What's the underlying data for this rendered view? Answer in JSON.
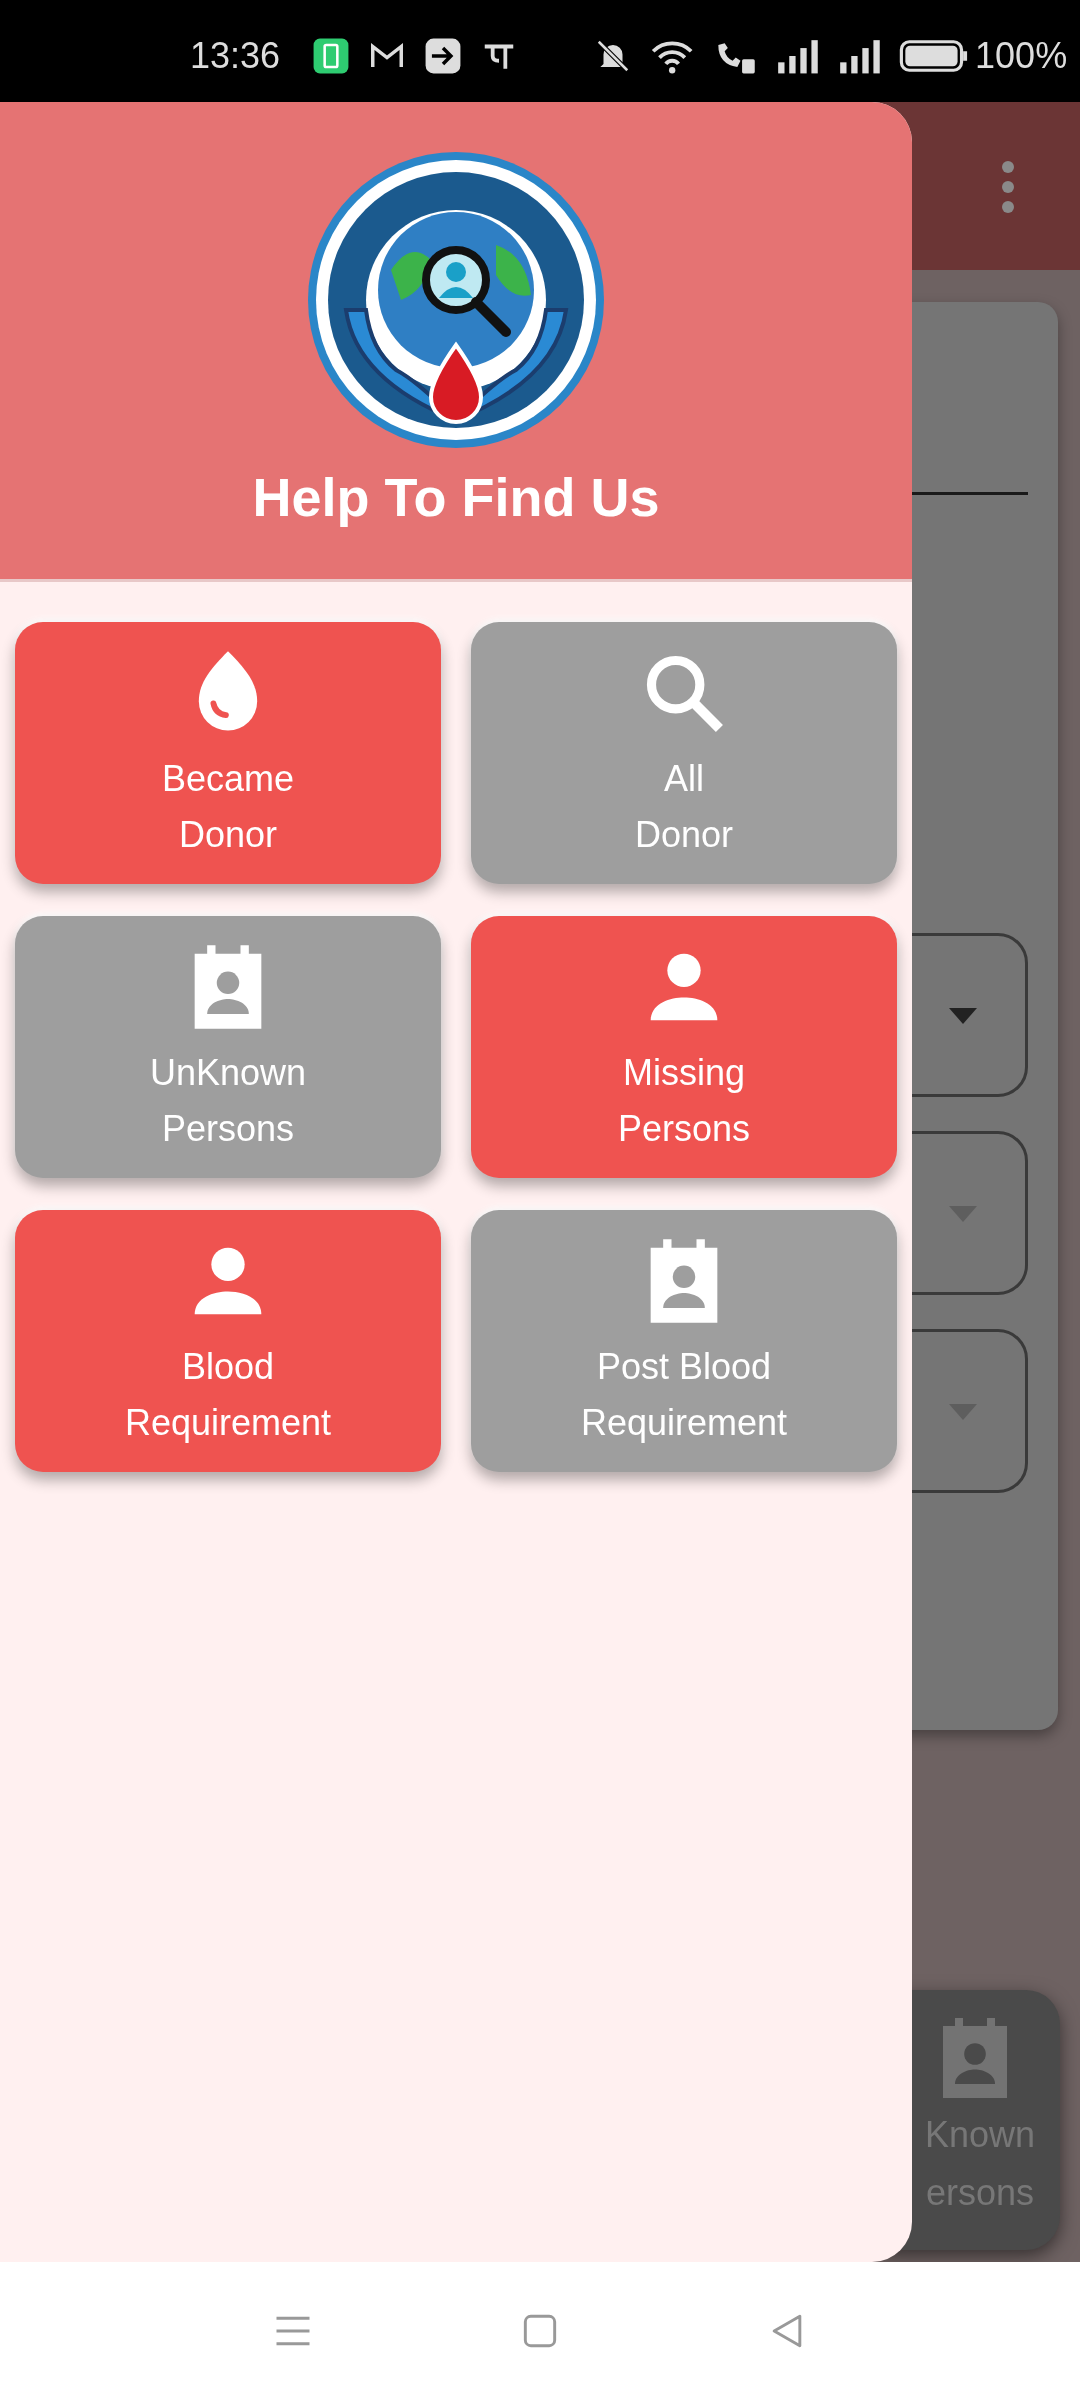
{
  "status_bar": {
    "time": "13:36",
    "battery": "100%"
  },
  "drawer": {
    "title": "Help To Find Us",
    "tiles": [
      {
        "label": "Became\nDonor",
        "color": "#ef5350"
      },
      {
        "label": "All\nDonor",
        "color": "#9e9e9e"
      },
      {
        "label": "UnKnown\nPersons",
        "color": "#9e9e9e"
      },
      {
        "label": "Missing\nPersons",
        "color": "#ef5350"
      },
      {
        "label": "Blood\nRequirement",
        "color": "#ef5350"
      },
      {
        "label": "Post Blood\nRequirement",
        "color": "#9e9e9e"
      }
    ]
  },
  "background": {
    "dropdowns": [
      {
        "disabled": false
      },
      {
        "disabled": true
      },
      {
        "disabled": true
      }
    ],
    "card_label": "Known\nersons"
  }
}
